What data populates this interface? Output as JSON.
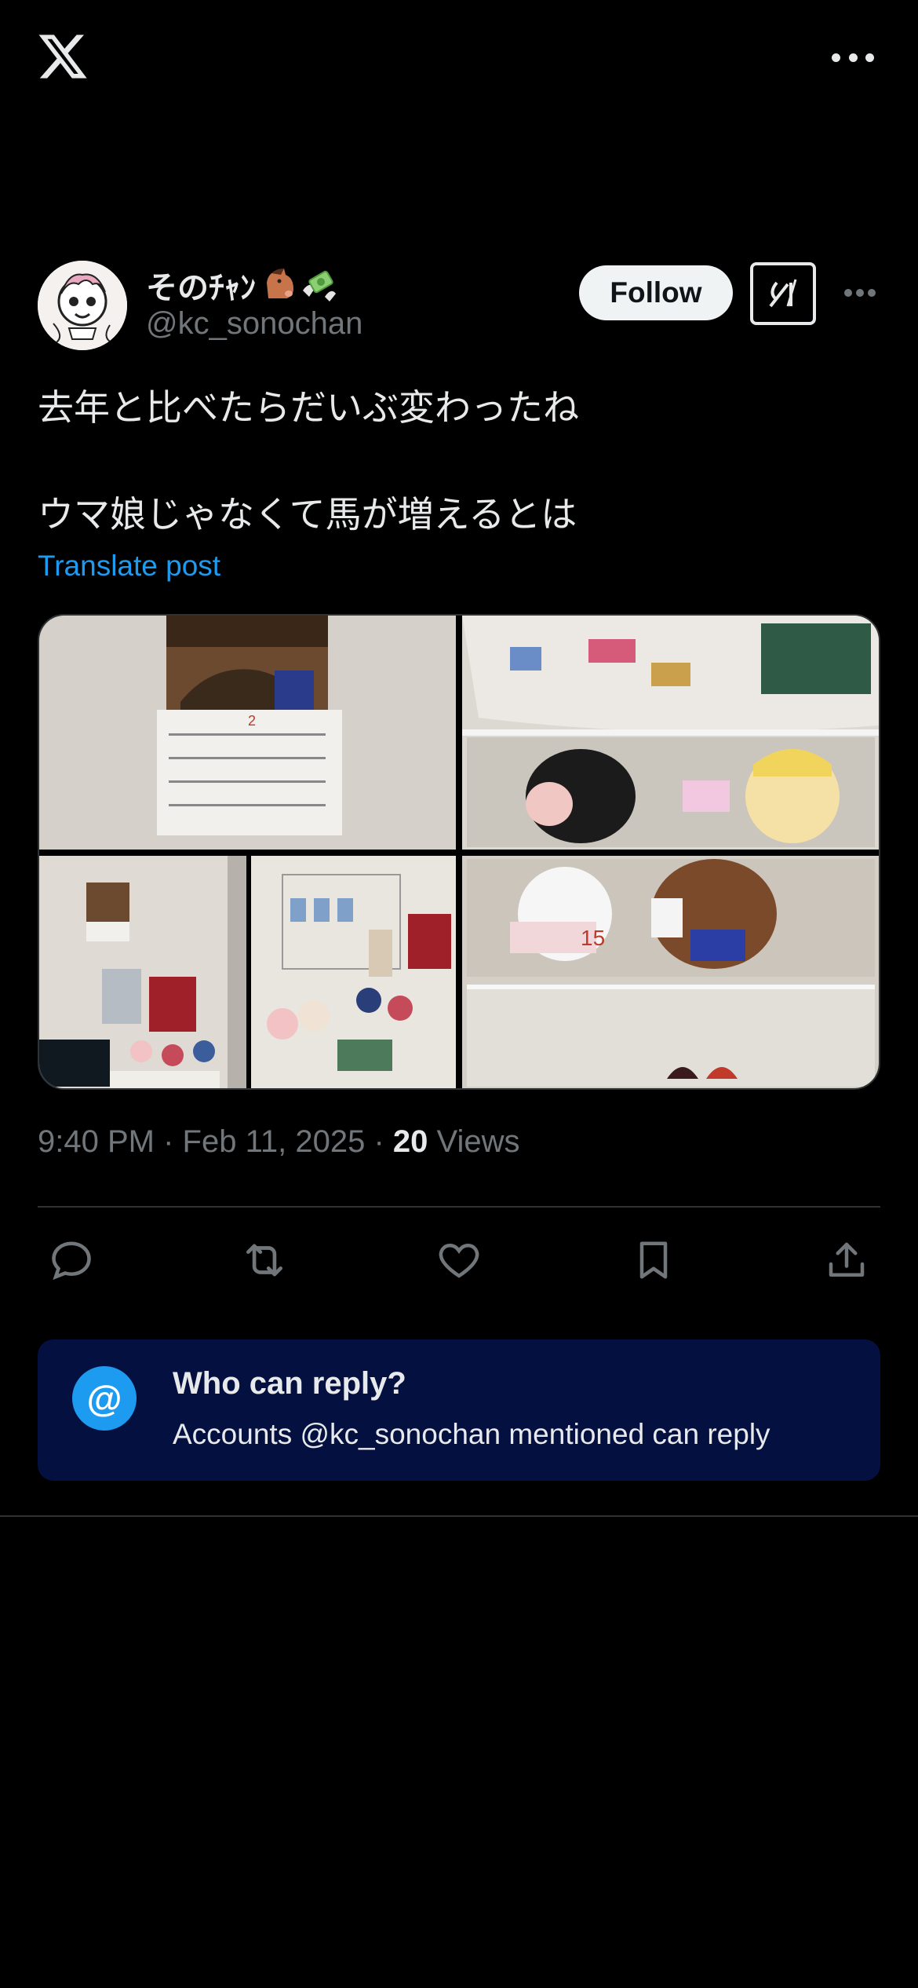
{
  "header": {
    "logo_icon": "x-logo-icon",
    "menu_icon": "more-horizontal-icon"
  },
  "author": {
    "display_name": "そのﾁｬﾝ",
    "name_emojis": [
      "horse-face-emoji",
      "money-with-wings-emoji"
    ],
    "handle": "@kc_sonochan",
    "follow_label": "Follow",
    "grok_icon": "grok-icon",
    "more_icon": "more-horizontal-icon"
  },
  "post": {
    "text": "去年と比べたらだいぶ変わったね\n\nウマ娘じゃなくて馬が増えるとは",
    "translate_label": "Translate post",
    "media_count": 4,
    "time": "9:40 PM",
    "date": "Feb 11, 2025",
    "separator": "·",
    "views_count": "20",
    "views_label": "Views"
  },
  "actions": [
    {
      "name": "reply",
      "icon": "reply-icon"
    },
    {
      "name": "repost",
      "icon": "repost-icon"
    },
    {
      "name": "like",
      "icon": "heart-icon"
    },
    {
      "name": "bookmark",
      "icon": "bookmark-icon"
    },
    {
      "name": "share",
      "icon": "share-icon"
    }
  ],
  "reply_restriction": {
    "icon": "at-icon",
    "icon_glyph": "@",
    "title": "Who can reply?",
    "subtitle": "Accounts @kc_sonochan mentioned can reply"
  },
  "colors": {
    "background": "#000000",
    "accent": "#1d9bf0",
    "muted": "#71767b",
    "reply_box": "#041040"
  }
}
